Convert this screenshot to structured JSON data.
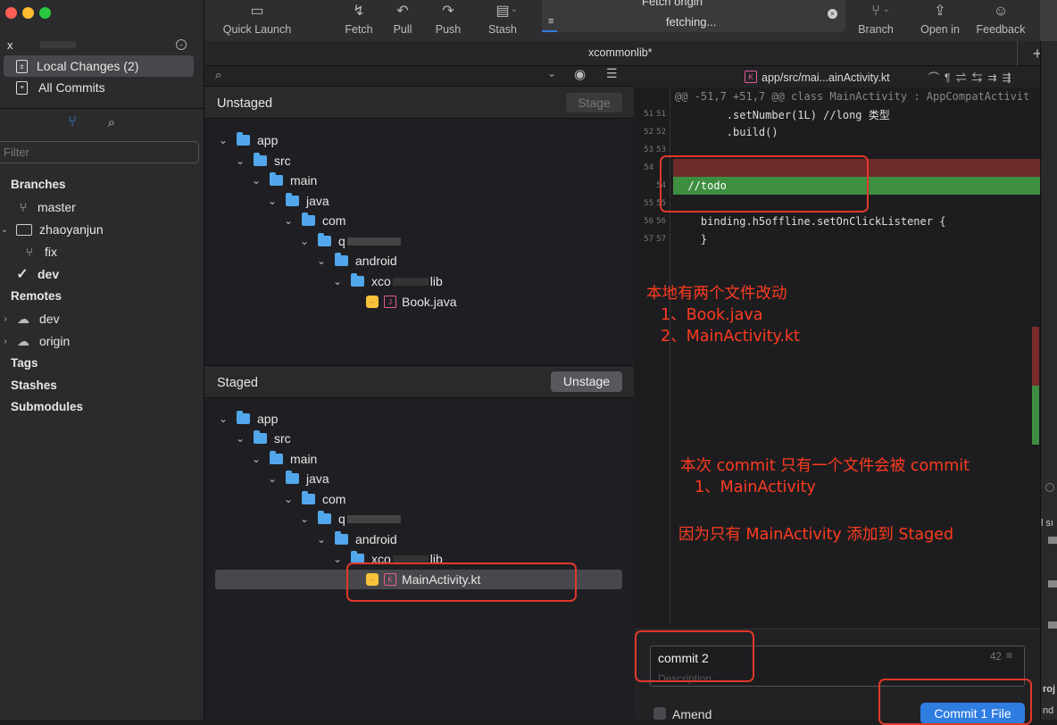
{
  "sidebar": {
    "repo_label": "x",
    "local_changes": "Local Changes (2)",
    "all_commits": "All Commits",
    "filter_placeholder": "Filter",
    "branches_hdr": "Branches",
    "branches": [
      "master",
      "zhaoyanjun",
      "fix",
      "dev"
    ],
    "remotes_hdr": "Remotes",
    "remotes": [
      "dev",
      "origin"
    ],
    "tags": "Tags",
    "stashes": "Stashes",
    "submodules": "Submodules"
  },
  "toolbar": {
    "quick_launch": "Quick Launch",
    "fetch": "Fetch",
    "pull": "Pull",
    "push": "Push",
    "stash": "Stash",
    "activity_title": "Fetch origin",
    "activity_status": "fetching...",
    "branch": "Branch",
    "open_in": "Open in",
    "feedback": "Feedback"
  },
  "tab": {
    "title": "xcommonlib*",
    "add": "+"
  },
  "unstaged": {
    "title": "Unstaged",
    "button": "Stage",
    "tree": [
      "app",
      "src",
      "main",
      "java",
      "com",
      "q",
      "android",
      "xco",
      "Book.java"
    ],
    "tree_tail": "lib"
  },
  "staged": {
    "title": "Staged",
    "button": "Unstage",
    "tree": [
      "app",
      "src",
      "main",
      "java",
      "com",
      "q",
      "android",
      "xco",
      "MainActivity.kt"
    ],
    "tree_tail": "lib"
  },
  "diff": {
    "path": "app/src/mai...ainActivity.kt",
    "hunk": "@@ -51,7 +51,7 @@ class MainActivity : AppCompatActivit",
    "lines": [
      {
        "a": "51",
        "b": "51",
        "text": "        .setNumber(1L) //long 类型"
      },
      {
        "a": "52",
        "b": "52",
        "text": "        .build()"
      },
      {
        "a": "53",
        "b": "53",
        "text": ""
      },
      {
        "a": "54",
        "b": "",
        "text": ""
      },
      {
        "a": "",
        "b": "54",
        "text": "  //todo"
      },
      {
        "a": "55",
        "b": "55",
        "text": ""
      },
      {
        "a": "56",
        "b": "56",
        "text": "    binding.h5offline.setOnClickListener {"
      },
      {
        "a": "57",
        "b": "57",
        "text": "    }"
      }
    ]
  },
  "annotations": {
    "note1_l1": "本地有两个文件改动",
    "note1_l2": "1、Book.java",
    "note1_l3": "2、MainActivity.kt",
    "note2_l1": "本次 commit 只有一个文件会被 commit",
    "note2_l2": "1、MainActivity",
    "note3": "因为只有 MainActivity 添加到 Staged"
  },
  "commit": {
    "message": "commit 2",
    "count": "42",
    "description_placeholder": "Description",
    "amend": "Amend",
    "button": "Commit 1 File"
  },
  "right_edge": {
    "text1": "l sı",
    "text2": "roj",
    "text3": "nd"
  },
  "colors": {
    "accent": "#2f7de1",
    "annotation": "#ff3b1f",
    "folder": "#52a7ec",
    "added": "#3e8e41",
    "removed": "#7a2b2b"
  }
}
